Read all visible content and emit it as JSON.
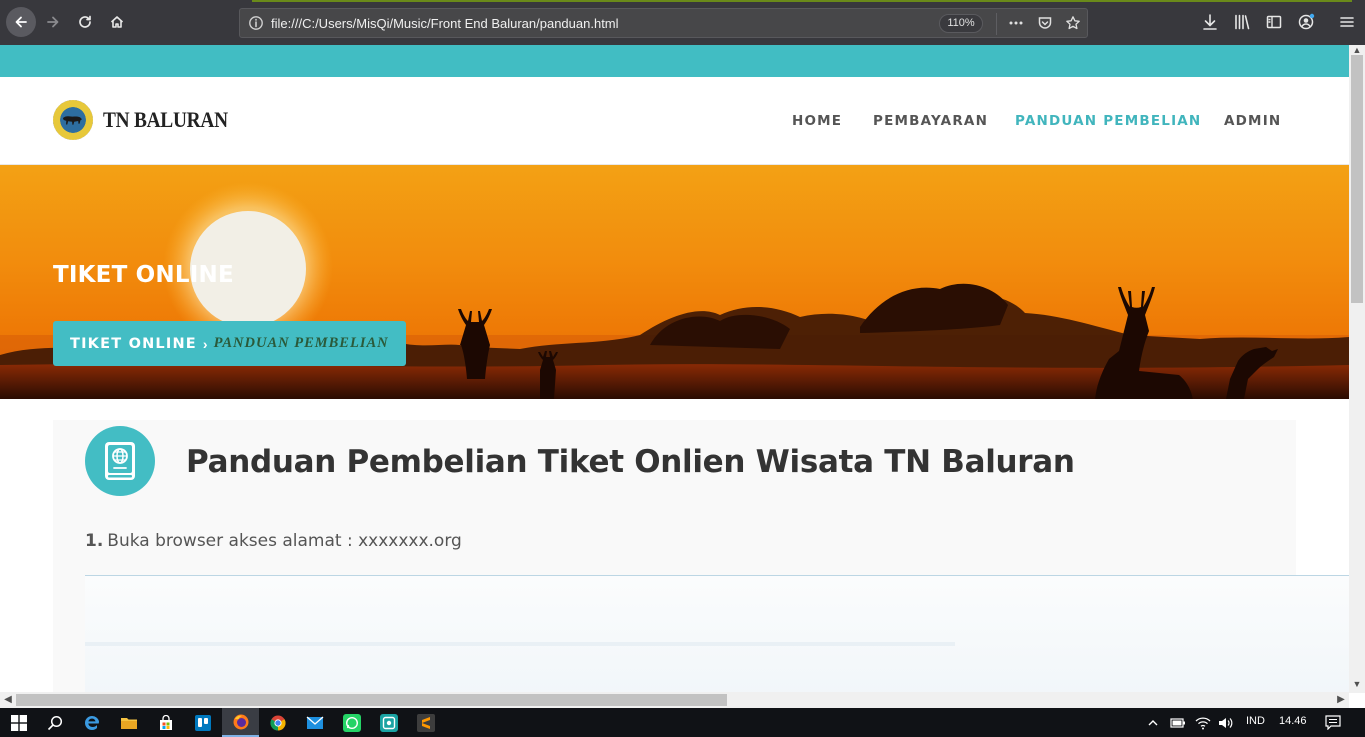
{
  "browser": {
    "url": "file:///C:/Users/MisQi/Music/Front End Baluran/panduan.html",
    "zoom": "110%",
    "icons": [
      "back-icon",
      "forward-icon",
      "reload-icon",
      "home-icon",
      "info-icon",
      "more-icon",
      "pocket-icon",
      "bookmark-star-icon",
      "download-icon",
      "library-icon",
      "sidebar-icon",
      "account-icon",
      "menu-icon"
    ]
  },
  "site": {
    "name": "TN BALURAN",
    "nav": [
      {
        "label": "HOME",
        "active": false
      },
      {
        "label": "PEMBAYARAN",
        "active": false
      },
      {
        "label": "PANDUAN PEMBELIAN",
        "active": true
      },
      {
        "label": "ADMIN",
        "active": false
      }
    ],
    "accent_color": "#41bdc3"
  },
  "hero": {
    "title": "TIKET ONLINE",
    "breadcrumb": {
      "root": "TIKET ONLINE",
      "current": "PANDUAN PEMBELIAN"
    }
  },
  "content": {
    "title": "Panduan Pembelian Tiket Onlien Wisata TN Baluran",
    "steps": [
      {
        "num": "1.",
        "text": "Buka browser akses alamat : xxxxxxx.org"
      }
    ]
  },
  "taskbar": {
    "lang": "IND",
    "time": "14.46",
    "apps": [
      "windows-start-icon",
      "search-icon",
      "edge-icon",
      "file-explorer-icon",
      "store-icon",
      "trello-icon",
      "firefox-icon",
      "chrome-icon",
      "mail-icon",
      "whatsapp-icon",
      "app-icon",
      "sublime-text-icon"
    ]
  }
}
